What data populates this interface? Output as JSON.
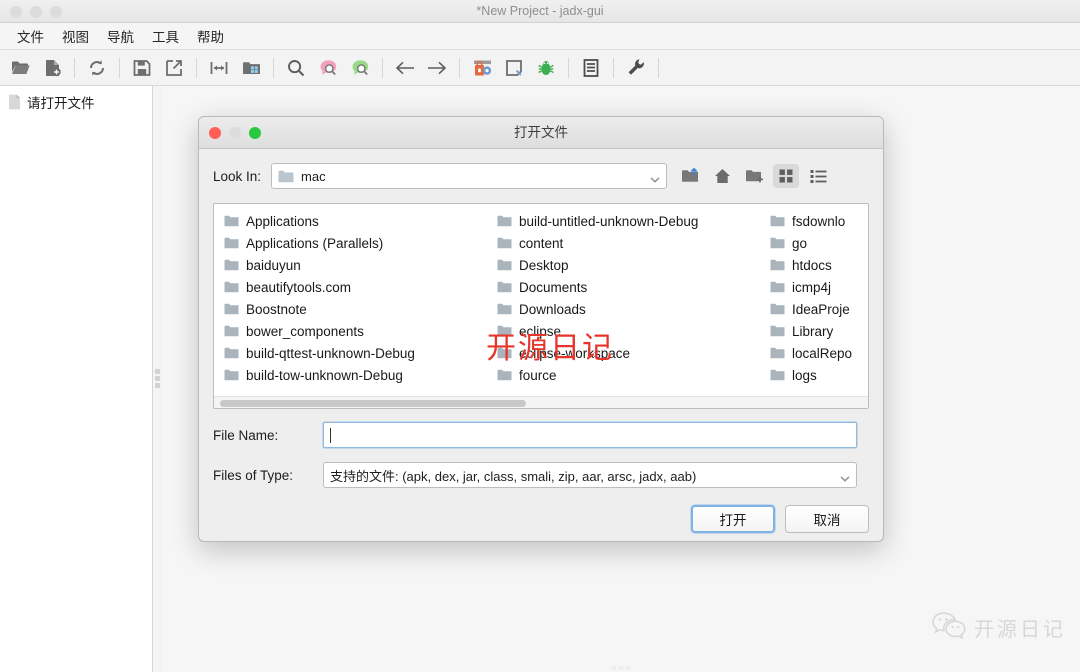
{
  "window": {
    "title": "*New Project - jadx-gui",
    "traffic_lights": [
      "close",
      "minimize",
      "maximize"
    ]
  },
  "menubar": {
    "items": [
      {
        "label": "文件",
        "name": "menu-file"
      },
      {
        "label": "视图",
        "name": "menu-view"
      },
      {
        "label": "导航",
        "name": "menu-navigation"
      },
      {
        "label": "工具",
        "name": "menu-tools"
      },
      {
        "label": "帮助",
        "name": "menu-help"
      }
    ]
  },
  "toolbar": {
    "buttons": [
      {
        "icon": "open-folder-icon",
        "name": "open-file-button"
      },
      {
        "icon": "add-file-icon",
        "name": "add-files-button"
      },
      {
        "sep": true
      },
      {
        "icon": "reload-icon",
        "name": "reload-button"
      },
      {
        "sep": true
      },
      {
        "icon": "save-icon",
        "name": "save-all-button"
      },
      {
        "icon": "export-icon",
        "name": "export-gradle-button"
      },
      {
        "sep": true
      },
      {
        "icon": "sync-icon",
        "name": "sync-button"
      },
      {
        "icon": "flatten-icon",
        "name": "flat-packages-button"
      },
      {
        "sep": true
      },
      {
        "icon": "search-icon",
        "name": "text-search-button"
      },
      {
        "icon": "search-class-icon",
        "name": "class-search-button"
      },
      {
        "icon": "search-comment-icon",
        "name": "comment-search-button"
      },
      {
        "sep": true
      },
      {
        "icon": "arrow-left-icon",
        "name": "back-button"
      },
      {
        "icon": "arrow-right-icon",
        "name": "forward-button"
      },
      {
        "sep": true
      },
      {
        "icon": "deobfuscation-icon",
        "name": "deobfuscation-button"
      },
      {
        "icon": "quark-icon",
        "name": "quark-button"
      },
      {
        "icon": "bug-icon",
        "name": "debugger-button"
      },
      {
        "sep": true
      },
      {
        "icon": "logs-icon",
        "name": "logs-button"
      },
      {
        "sep": true
      },
      {
        "icon": "wrench-icon",
        "name": "preferences-button"
      },
      {
        "sep": true
      }
    ]
  },
  "sidebar": {
    "root_label": "请打开文件",
    "root_icon": "file-icon"
  },
  "dialog": {
    "title": "打开文件",
    "traffic_lights": [
      "close",
      "minimize",
      "maximize"
    ],
    "lookin": {
      "label": "Look In:",
      "value": "mac",
      "icon": "folder-icon"
    },
    "nav_buttons": [
      {
        "icon": "up-folder-icon",
        "name": "go-up-button",
        "active": false
      },
      {
        "icon": "home-icon",
        "name": "home-button",
        "active": false
      },
      {
        "icon": "new-folder-icon",
        "name": "new-folder-button",
        "active": false
      },
      {
        "icon": "grid-view-icon",
        "name": "tile-view-button",
        "active": true
      },
      {
        "icon": "list-view-icon",
        "name": "list-view-button",
        "active": false
      }
    ],
    "file_columns": [
      [
        "Applications",
        "Applications (Parallels)",
        "baiduyun",
        "beautifytools.com",
        "Boostnote",
        "bower_components",
        "build-qttest-unknown-Debug",
        "build-tow-unknown-Debug"
      ],
      [
        "build-untitled-unknown-Debug",
        "content",
        "Desktop",
        "Documents",
        "Downloads",
        "eclipse",
        "eclipse-workspace",
        "fource"
      ],
      [
        "fsdownlo",
        "go",
        "htdocs",
        "icmp4j",
        "IdeaProje",
        "Library",
        "localRepo",
        "logs"
      ]
    ],
    "file_name": {
      "label": "File Name:",
      "value": "",
      "placeholder": ""
    },
    "files_of_type": {
      "label": "Files of Type:",
      "value": "支持的文件: (apk, dex, jar, class, smali, zip, aar, arsc, jadx, aab)"
    },
    "buttons": {
      "open": "打开",
      "cancel": "取消"
    }
  },
  "watermarks": {
    "overlay_text": "开源日记",
    "overlay_color": "#e8352c",
    "badge_text": "开源日记",
    "badge_icon": "wechat-icon",
    "badge_color": "#d6d6d6"
  }
}
